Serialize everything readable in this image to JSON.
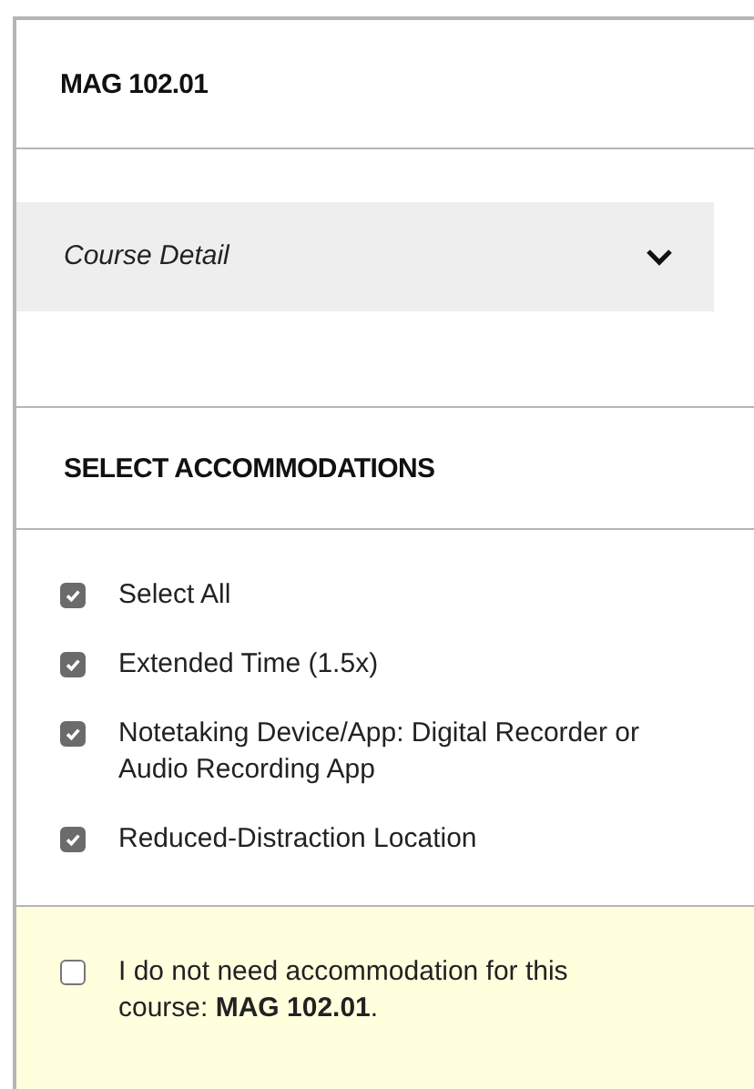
{
  "course_code": "MAG 102.01",
  "course_detail": {
    "label": "Course Detail",
    "expanded": false
  },
  "section_title": "SELECT ACCOMMODATIONS",
  "accommodations": [
    {
      "label": "Select All",
      "checked": true
    },
    {
      "label": "Extended Time (1.5x)",
      "checked": true
    },
    {
      "label": "Notetaking Device/App: Digital Recorder or Audio Recording App",
      "checked": true
    },
    {
      "label": "Reduced-Distraction Location",
      "checked": true
    }
  ],
  "opt_out": {
    "label": "I do not need accommodation for this course: **MAG 102.01**.",
    "checked": false
  }
}
